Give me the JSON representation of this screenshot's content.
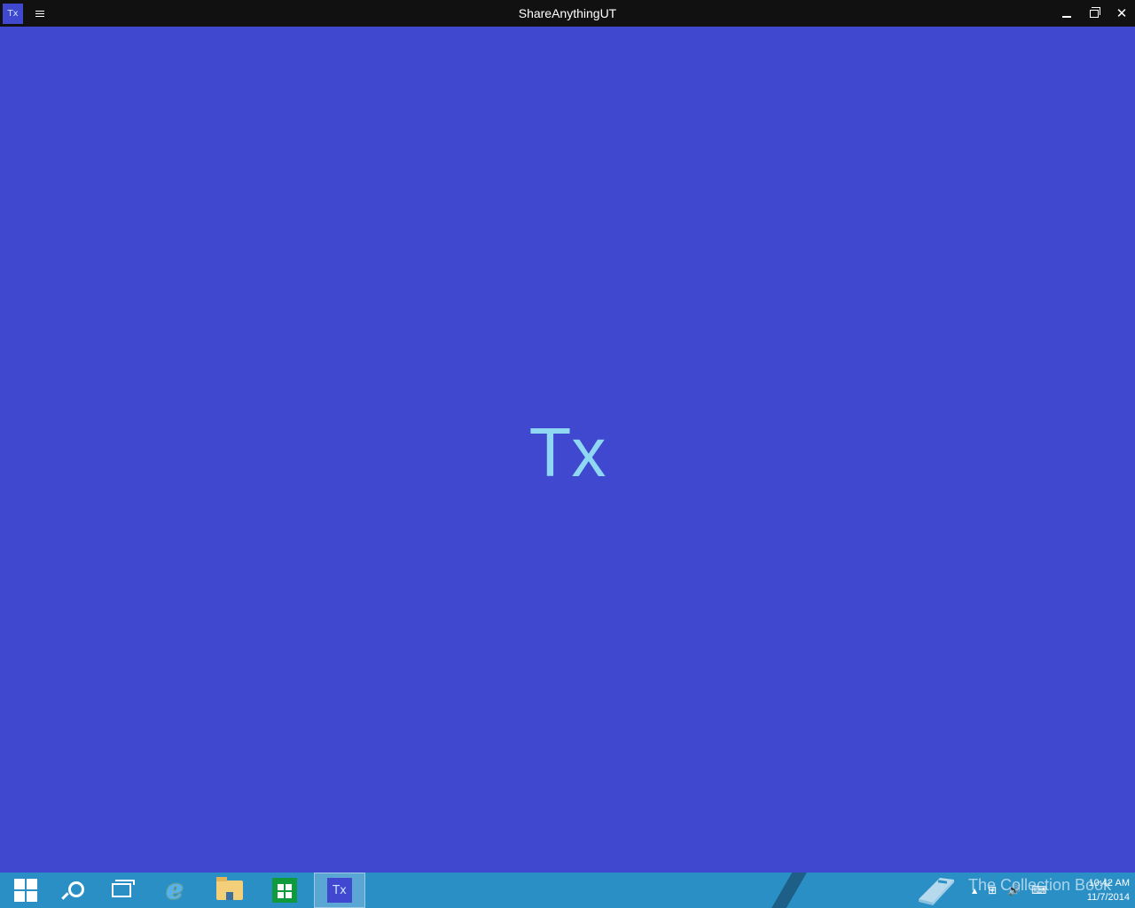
{
  "window": {
    "title": "ShareAnythingUT",
    "app_icon_label": "Tx",
    "minimize_label": "",
    "maximize_label": "",
    "close_label": "✕"
  },
  "content": {
    "center_logo": "Tx"
  },
  "taskbar": {
    "items": [
      {
        "name": "start",
        "icon": "windows-logo-icon"
      },
      {
        "name": "search",
        "icon": "search-icon"
      },
      {
        "name": "task-view",
        "icon": "task-view-icon"
      },
      {
        "name": "internet-explorer",
        "icon": "ie-icon",
        "glyph": "e"
      },
      {
        "name": "file-explorer",
        "icon": "folder-icon"
      },
      {
        "name": "store",
        "icon": "store-icon"
      },
      {
        "name": "shareanythingut",
        "icon": "app-icon",
        "glyph": "Tx"
      }
    ],
    "watermark_text": "The Collection Book",
    "tray": {
      "up_arrow": "▲",
      "network": "⊞",
      "volume": "🔊",
      "keyboard": "⌨"
    },
    "clock": {
      "time": "10:42 AM",
      "date": "11/7/2014"
    }
  },
  "colors": {
    "background": "#3f48cf",
    "titlebar": "#111111",
    "logo_text": "#8fd7f2",
    "taskbar": "#2a8fc4"
  }
}
